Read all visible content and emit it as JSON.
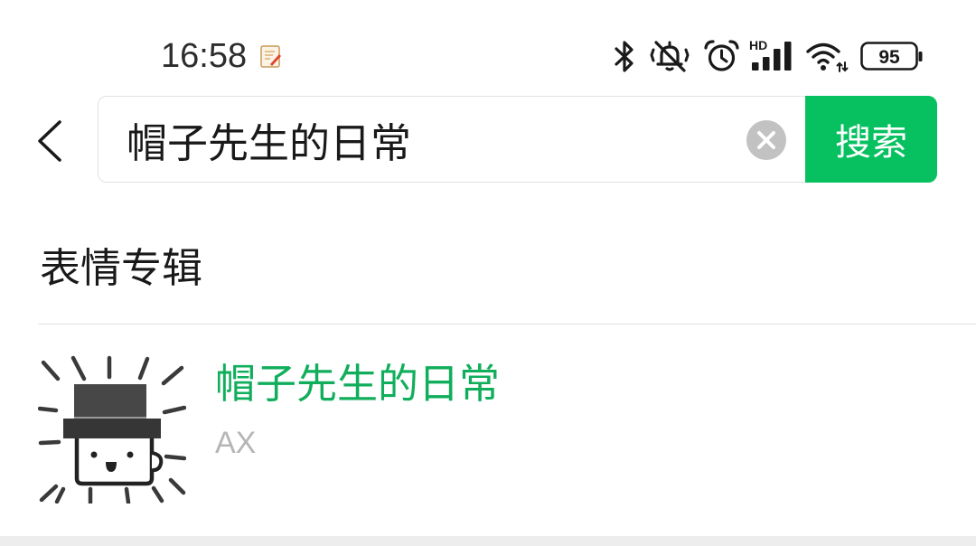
{
  "status_bar": {
    "time": "16:58",
    "notification_icon": "notepad-icon",
    "icons": [
      "bluetooth-icon",
      "mute-icon",
      "alarm-icon",
      "signal-icon",
      "wifi-icon",
      "battery-icon"
    ],
    "signal_label": "HD",
    "battery_level": "95"
  },
  "search": {
    "back_icon": "chevron-left-icon",
    "query": "帽子先生的日常",
    "clear_icon": "clear-icon",
    "button_label": "搜索"
  },
  "section": {
    "title": "表情专辑"
  },
  "results": [
    {
      "thumbnail_icon": "top-hat-character-sticker",
      "title": "帽子先生的日常",
      "author": "AX"
    }
  ],
  "colors": {
    "accent": "#07c160",
    "title_green": "#10ae5b",
    "text_primary": "#191919",
    "text_secondary": "#b5b5b5",
    "divider": "#e2e2e2",
    "bottom_band": "#ededed"
  }
}
